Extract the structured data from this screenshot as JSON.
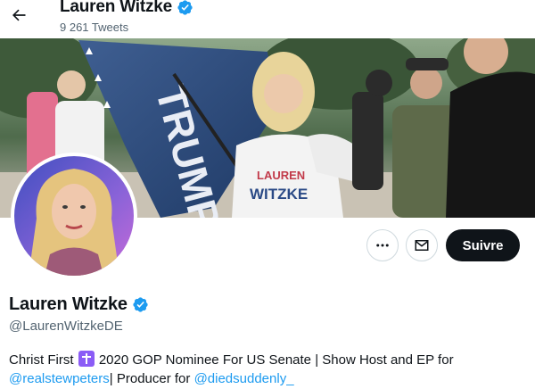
{
  "header": {
    "back_icon": "arrow-left-icon",
    "name": "Lauren Witzke",
    "tweet_count": "9 261 Tweets",
    "verified_color": "#1d9bf0"
  },
  "banner": {
    "description": "Rally photo with flags and supporters",
    "shirt_text": "LAUREN WITZKE"
  },
  "actions": {
    "more_icon": "more-horizontal-icon",
    "message_icon": "mail-icon",
    "follow_label": "Suivre"
  },
  "profile": {
    "name": "Lauren Witzke",
    "handle": "@LaurenWitzkeDE"
  },
  "bio": {
    "part1": "Christ First",
    "cross_icon": "latin-cross-emoji",
    "part2": "2020 GOP Nominee For US Senate | Show Host and EP for",
    "mention1": "@realstewpeters",
    "part3": "| Producer for",
    "mention2": "@diedsuddenly_"
  },
  "colors": {
    "link": "#1d9bf0",
    "secondary_text": "#536471",
    "button_dark": "#0f1419"
  }
}
